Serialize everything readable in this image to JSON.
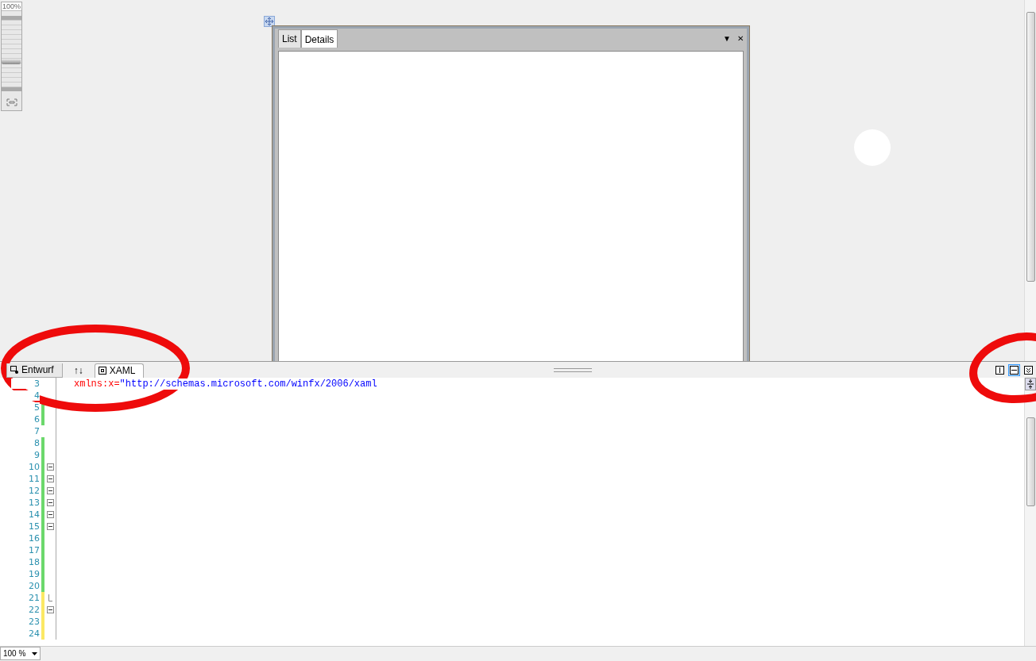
{
  "designer": {
    "zoom_label": "100%",
    "zoom_slider": {
      "level": 0.4
    },
    "window": {
      "tabs": [
        {
          "label": "List",
          "selected": false
        },
        {
          "label": "Details",
          "selected": true
        }
      ],
      "menu_glyph": "▼",
      "close_glyph": "✕"
    }
  },
  "view_tabs": [
    {
      "kind": "design",
      "label": "Entwurf",
      "selected": false
    },
    {
      "kind": "xaml",
      "label": "XAML",
      "selected": true
    }
  ],
  "swap_button": {
    "label": "↑↓"
  },
  "layout_buttons": [
    {
      "kind": "vertical",
      "selected": false
    },
    {
      "kind": "horizontal",
      "selected": true
    },
    {
      "kind": "collapse",
      "selected": false
    }
  ],
  "editor": {
    "lines": [
      {
        "number": "3",
        "foldable": false,
        "fold_end": false,
        "code": [
          {
            "kind": "attr",
            "text": "xmlns:x="
          },
          {
            "kind": "value",
            "text": "\"http://schemas.microsoft.com/winfx/2006/xaml"
          }
        ]
      },
      {
        "number": "4",
        "foldable": false,
        "fold_end": false
      },
      {
        "number": "5",
        "color": "#6cd86c",
        "foldable": false,
        "fold_end": false
      },
      {
        "number": "6",
        "color": "#6cd86c",
        "foldable": false,
        "fold_end": false
      },
      {
        "number": "7",
        "foldable": false,
        "fold_end": false
      },
      {
        "number": "8",
        "color": "#6cd86c",
        "foldable": false,
        "fold_end": false
      },
      {
        "number": "9",
        "color": "#6cd86c",
        "foldable": false,
        "fold_end": false
      },
      {
        "number": "10",
        "color": "#6cd86c",
        "foldable": true,
        "fold_end": false
      },
      {
        "number": "11",
        "color": "#6cd86c",
        "foldable": true,
        "fold_end": false
      },
      {
        "number": "12",
        "color": "#6cd86c",
        "foldable": true,
        "fold_end": false
      },
      {
        "number": "13",
        "color": "#6cd86c",
        "foldable": true,
        "fold_end": false
      },
      {
        "number": "14",
        "color": "#6cd86c",
        "foldable": true,
        "fold_end": false
      },
      {
        "number": "15",
        "color": "#6cd86c",
        "foldable": true,
        "fold_end": false
      },
      {
        "number": "16",
        "color": "#6cd86c",
        "foldable": false,
        "fold_end": false
      },
      {
        "number": "17",
        "color": "#6cd86c",
        "foldable": false,
        "fold_end": false
      },
      {
        "number": "18",
        "color": "#6cd86c",
        "foldable": false,
        "fold_end": false
      },
      {
        "number": "19",
        "color": "#6cd86c",
        "foldable": false,
        "fold_end": false
      },
      {
        "number": "20",
        "color": "#6cd86c",
        "foldable": false,
        "fold_end": false
      },
      {
        "number": "21",
        "color": "#fbe864",
        "foldable": false,
        "fold_end": true
      },
      {
        "number": "22",
        "color": "#fbe864",
        "foldable": true,
        "fold_end": false
      },
      {
        "number": "23",
        "color": "#fbe864",
        "foldable": false,
        "fold_end": false
      },
      {
        "number": "24",
        "color": "#fbe864",
        "foldable": false,
        "fold_end": false
      }
    ]
  },
  "status_bar": {
    "zoom": "100 %"
  }
}
